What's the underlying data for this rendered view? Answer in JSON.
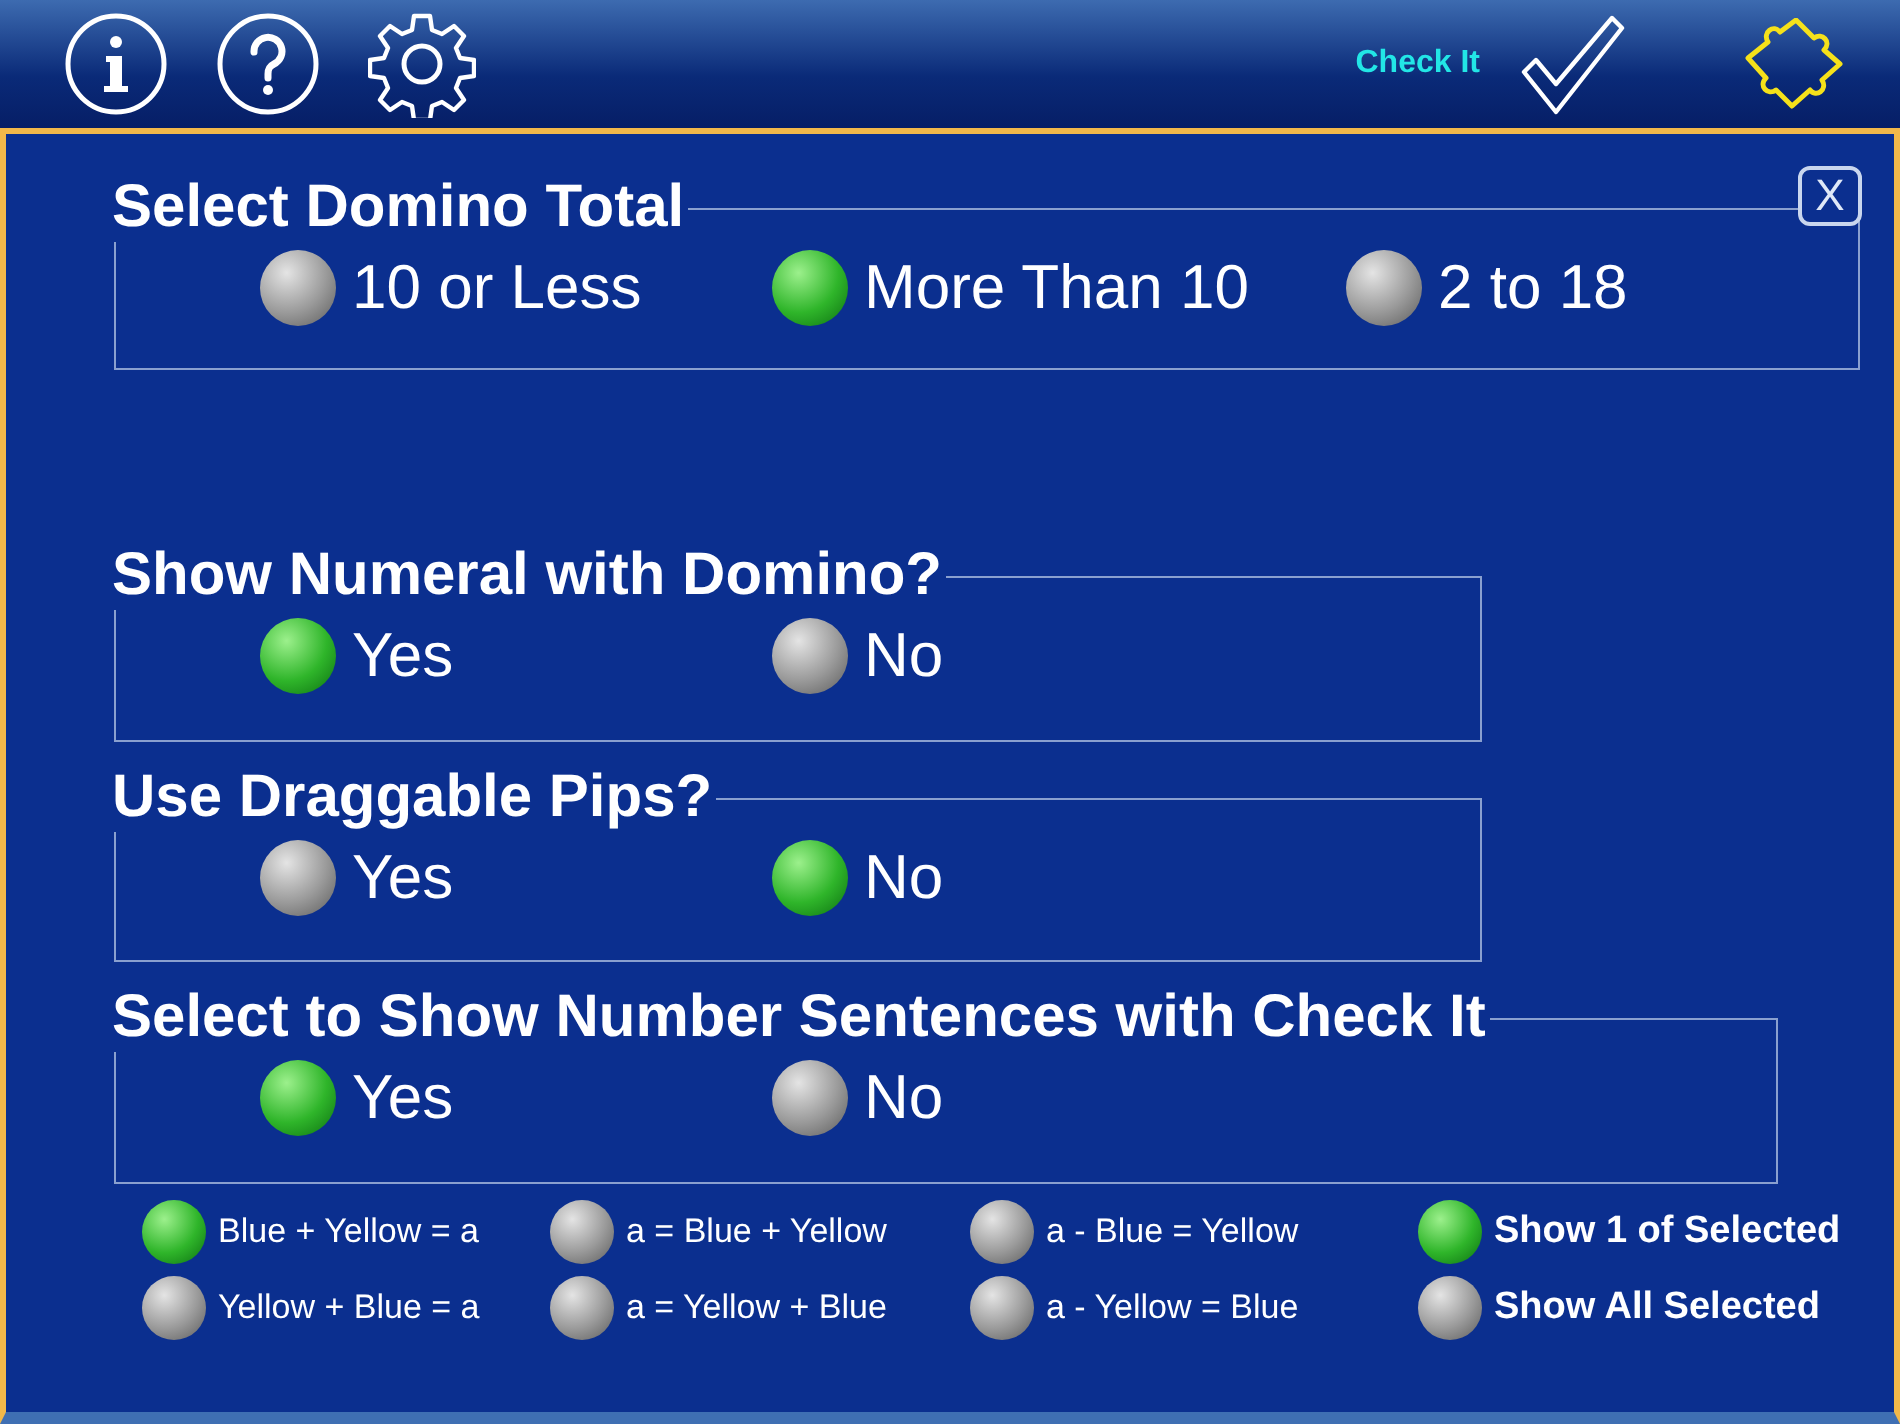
{
  "toolbar": {
    "check_label": "Check It"
  },
  "close_label": "X",
  "groups": [
    {
      "title": "Select Domino Total",
      "options": [
        {
          "label": "10 or Less",
          "selected": false
        },
        {
          "label": "More Than 10",
          "selected": true
        },
        {
          "label": "2 to 18",
          "selected": false
        }
      ]
    },
    {
      "title": "Show Numeral with Domino?",
      "options": [
        {
          "label": "Yes",
          "selected": true
        },
        {
          "label": "No",
          "selected": false
        }
      ]
    },
    {
      "title": "Use Draggable Pips?",
      "options": [
        {
          "label": "Yes",
          "selected": false
        },
        {
          "label": "No",
          "selected": true
        }
      ]
    },
    {
      "title": "Select to Show Number Sentences with Check It",
      "options": [
        {
          "label": "Yes",
          "selected": true
        },
        {
          "label": "No",
          "selected": false
        }
      ]
    }
  ],
  "sentences": [
    {
      "label": "Blue + Yellow = a",
      "selected": true
    },
    {
      "label": "a = Blue + Yellow",
      "selected": false
    },
    {
      "label": "a - Blue = Yellow",
      "selected": false
    },
    {
      "label": "Show 1 of Selected",
      "selected": true,
      "kind": "mode"
    },
    {
      "label": "Yellow + Blue = a",
      "selected": false
    },
    {
      "label": "a = Yellow + Blue",
      "selected": false
    },
    {
      "label": "a - Yellow = Blue",
      "selected": false
    },
    {
      "label": "Show All Selected",
      "selected": false,
      "kind": "mode"
    }
  ]
}
